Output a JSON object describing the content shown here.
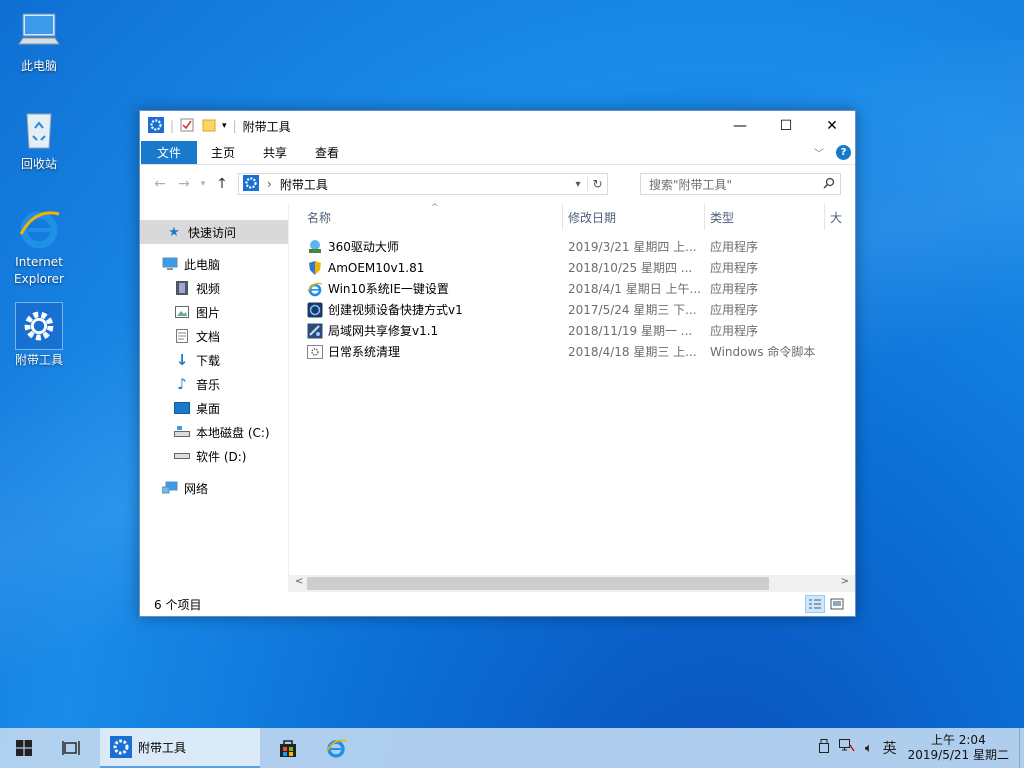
{
  "colors": {
    "accent": "#1979ca",
    "desktop": "#0b6fd6",
    "taskbar": "#bed7f0"
  },
  "desktop": {
    "icons": [
      {
        "label": "此电脑",
        "icon": "computer-icon"
      },
      {
        "label": "回收站",
        "icon": "recycle-bin-icon"
      },
      {
        "label": "Internet Explorer",
        "icon": "ie-icon"
      },
      {
        "label": "附带工具",
        "icon": "settings-gear-icon"
      }
    ]
  },
  "window": {
    "title": "附带工具",
    "controls": {
      "minimize": "—",
      "maximize": "☐",
      "close": "✕"
    },
    "ribbon_tabs": [
      "文件",
      "主页",
      "共享",
      "查看"
    ],
    "address": {
      "crumb": "附带工具",
      "separator": "›"
    },
    "search": {
      "placeholder": "搜索\"附带工具\""
    },
    "nav": {
      "quick_access": "快速访问",
      "this_pc": "此电脑",
      "items": [
        "视频",
        "图片",
        "文档",
        "下载",
        "音乐",
        "桌面",
        "本地磁盘 (C:)",
        "软件 (D:)"
      ],
      "network": "网络"
    },
    "columns": {
      "name": "名称",
      "date": "修改日期",
      "type": "类型",
      "size": "大"
    },
    "files": [
      {
        "name": "360驱动大师",
        "date": "2019/3/21 星期四 上...",
        "type": "应用程序"
      },
      {
        "name": "AmOEM10v1.81",
        "date": "2018/10/25 星期四 ...",
        "type": "应用程序"
      },
      {
        "name": "Win10系统IE一键设置",
        "date": "2018/4/1 星期日 上午...",
        "type": "应用程序"
      },
      {
        "name": "创建视频设备快捷方式v1",
        "date": "2017/5/24 星期三 下...",
        "type": "应用程序"
      },
      {
        "name": "局域网共享修复v1.1",
        "date": "2018/11/19 星期一 ...",
        "type": "应用程序"
      },
      {
        "name": "日常系统清理",
        "date": "2018/4/18 星期三 上...",
        "type": "Windows 命令脚本"
      }
    ],
    "status": "6 个项目"
  },
  "taskbar": {
    "app_label": "附带工具",
    "tray": {
      "ime": "英"
    },
    "clock": {
      "time": "上午 2:04",
      "date": "2019/5/21 星期二"
    }
  }
}
